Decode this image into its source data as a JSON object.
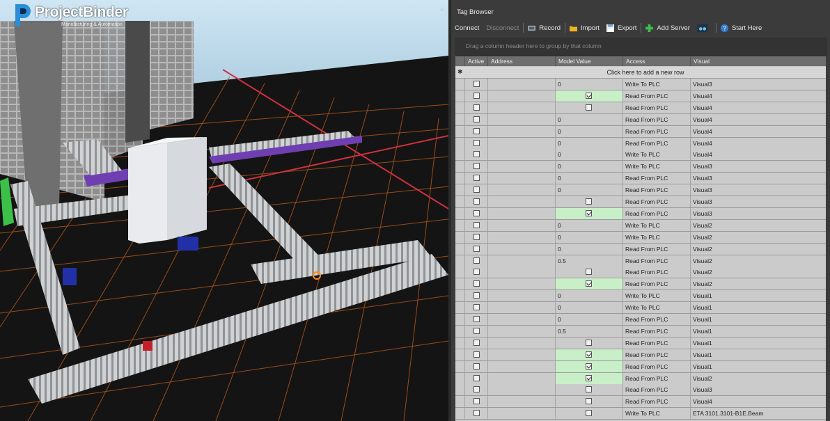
{
  "logo": {
    "brand": "ProjectBinder",
    "tagline": "Manufacturing & Automation"
  },
  "viewport": {
    "menu_glyph": "≡"
  },
  "panel": {
    "title": "Tag Browser",
    "toolbar": {
      "connect": "Connect",
      "disconnect": "Disconnect",
      "record": "Record",
      "import": "Import",
      "export": "Export",
      "add_server": "Add Server",
      "start_here": "Start Here"
    },
    "group_hint": "Drag a column header here to group by that column",
    "columns": {
      "active": "Active",
      "address": "Address",
      "model_value": "Model Value",
      "access": "Access",
      "visual": "Visual"
    },
    "new_row": "Click here to add a new row",
    "rows": [
      {
        "value": "0",
        "access": "Write To PLC",
        "visual": "Visual3"
      },
      {
        "check": true,
        "access": "Read From PLC",
        "visual": "Visual4"
      },
      {
        "check": false,
        "access": "Read From PLC",
        "visual": "Visual4"
      },
      {
        "value": "0",
        "access": "Read From PLC",
        "visual": "Visual4"
      },
      {
        "value": "0",
        "access": "Read From PLC",
        "visual": "Visual4"
      },
      {
        "value": "0",
        "access": "Read From PLC",
        "visual": "Visual4"
      },
      {
        "value": "0",
        "access": "Write To PLC",
        "visual": "Visual4"
      },
      {
        "value": "0",
        "access": "Write To PLC",
        "visual": "Visual3"
      },
      {
        "value": "0",
        "access": "Read From PLC",
        "visual": "Visual3"
      },
      {
        "value": "0",
        "access": "Read From PLC",
        "visual": "Visual3"
      },
      {
        "check": false,
        "access": "Read From PLC",
        "visual": "Visual3"
      },
      {
        "check": true,
        "access": "Read From PLC",
        "visual": "Visual3"
      },
      {
        "value": "0",
        "access": "Write To PLC",
        "visual": "Visual2"
      },
      {
        "value": "0",
        "access": "Write To PLC",
        "visual": "Visual2"
      },
      {
        "value": "0",
        "access": "Read From PLC",
        "visual": "Visual2"
      },
      {
        "value": "0.5",
        "access": "Read From PLC",
        "visual": "Visual2"
      },
      {
        "check": false,
        "access": "Read From PLC",
        "visual": "Visual2"
      },
      {
        "check": true,
        "access": "Read From PLC",
        "visual": "Visual2"
      },
      {
        "value": "0",
        "access": "Write To PLC",
        "visual": "Visual1"
      },
      {
        "value": "0",
        "access": "Write To PLC",
        "visual": "Visual1"
      },
      {
        "value": "0",
        "access": "Read From PLC",
        "visual": "Visual1"
      },
      {
        "value": "0.5",
        "access": "Read From PLC",
        "visual": "Visual1"
      },
      {
        "check": false,
        "access": "Read From PLC",
        "visual": "Visual1"
      },
      {
        "check": true,
        "access": "Read From PLC",
        "visual": "Visual1"
      },
      {
        "check": true,
        "access": "Read From PLC",
        "visual": "Visual1"
      },
      {
        "check": true,
        "access": "Read From PLC",
        "visual": "Visual2"
      },
      {
        "check": false,
        "access": "Read From PLC",
        "visual": "Visual3"
      },
      {
        "check": false,
        "access": "Read From PLC",
        "visual": "Visual4"
      },
      {
        "check": false,
        "access": "Write To PLC",
        "visual": "ETA 3101.3101-B1E.Beam"
      }
    ]
  },
  "colors": {
    "accent_green": "#c9efc8",
    "logo_blue": "#2a8fd8",
    "red_axis": "#d03040",
    "grid_orange": "#c2601e"
  }
}
